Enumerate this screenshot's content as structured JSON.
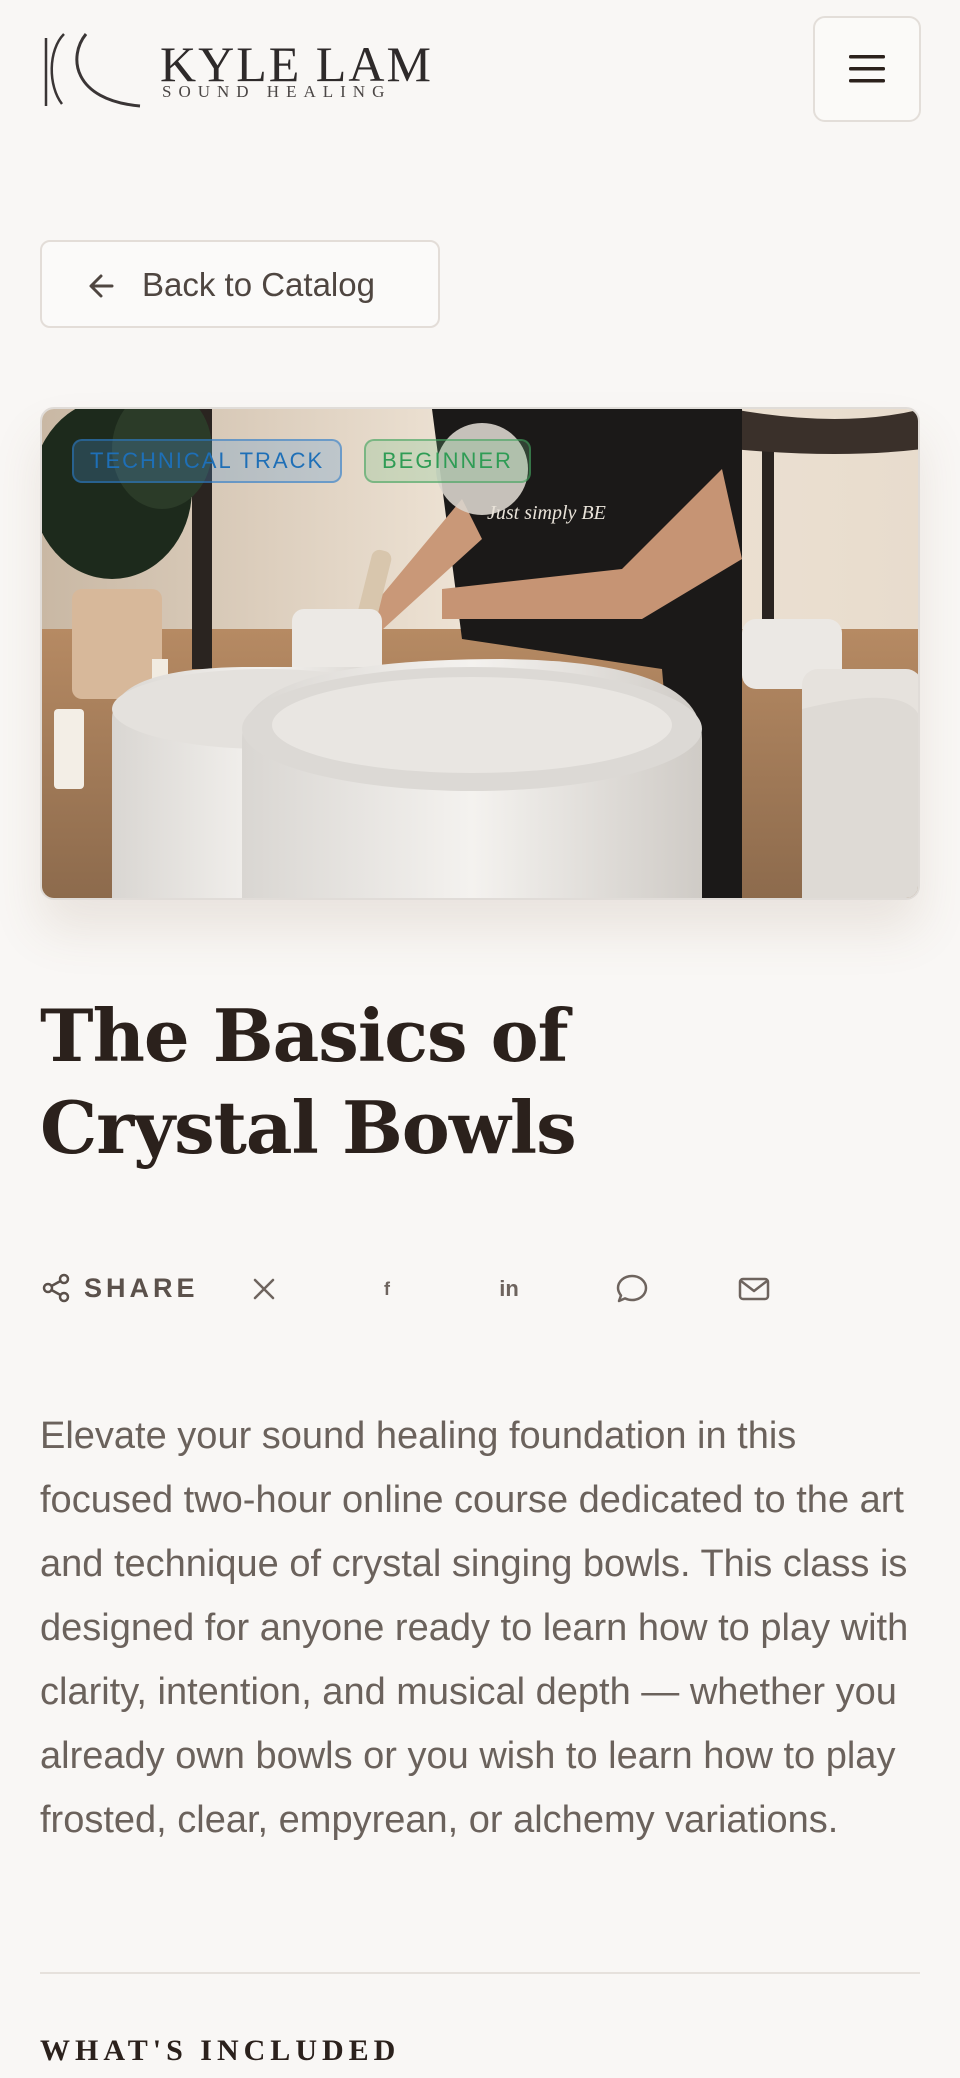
{
  "brand": {
    "name": "KYLE LAM",
    "tagline": "SOUND HEALING"
  },
  "nav": {
    "menu_icon": "hamburger-menu-icon"
  },
  "back_button": {
    "label": "Back to Catalog",
    "icon": "arrow-left-icon"
  },
  "hero": {
    "tags": [
      {
        "label": "TECHNICAL TRACK",
        "color": "#1e6fb7"
      },
      {
        "label": "BEGINNER",
        "color": "#2f9c55"
      }
    ],
    "shirt_text": "Just simply BE"
  },
  "course": {
    "title_line1": "The Basics of",
    "title_line2": "Crystal Bowls",
    "description": "Elevate your sound healing foundation in this focused two-hour online course dedicated to the art and technique of crystal singing bowls. This class is designed for anyone ready to learn how to play with clarity, intention, and musical depth — whether you already own bowls or you wish to learn how to play frosted, clear, empyrean, or alchemy variations."
  },
  "share": {
    "label": "SHARE",
    "icons": [
      "share-icon",
      "x-twitter-icon",
      "facebook-icon",
      "linkedin-icon",
      "message-icon",
      "email-icon"
    ],
    "facebook_glyph": "f",
    "linkedin_glyph": "in"
  },
  "sections": {
    "included_heading": "WHAT'S INCLUDED"
  },
  "colors": {
    "background": "#f9f7f5",
    "title": "#2b211c",
    "body_text": "#6b625c"
  }
}
